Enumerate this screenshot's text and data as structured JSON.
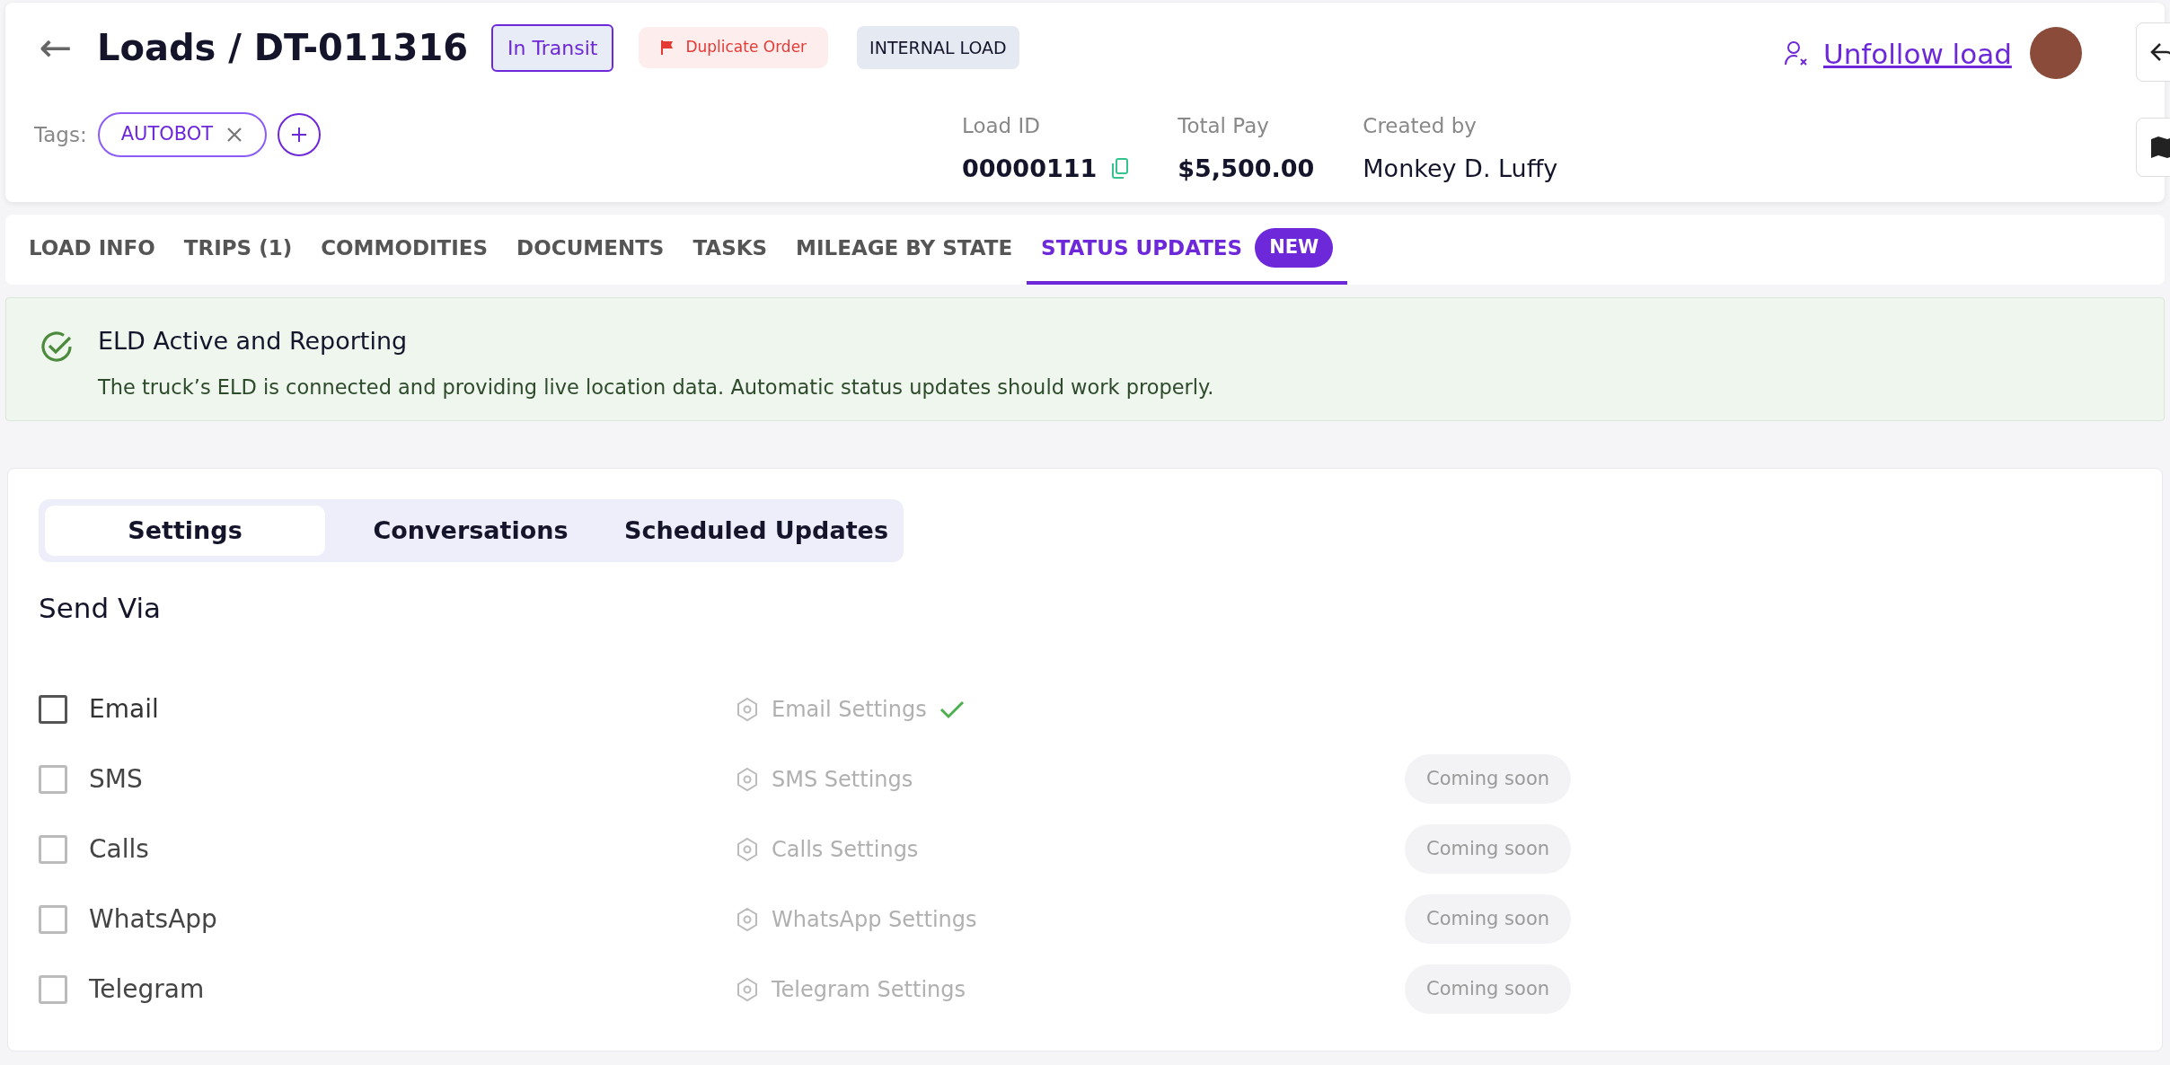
{
  "header": {
    "back": "←",
    "breadcrumb": "Loads / DT-011316",
    "status": "In Transit",
    "flag": "Duplicate Order",
    "load_type": "INTERNAL LOAD",
    "follow_link": "Unfollow load",
    "tags_label": "Tags:",
    "tags": [
      {
        "label": "AUTOBOT"
      }
    ],
    "stats": [
      {
        "label": "Load ID",
        "value": "00000111",
        "kind": "copy"
      },
      {
        "label": "Total Pay",
        "value": "$5,500.00",
        "kind": "bold"
      },
      {
        "label": "Created by",
        "value": "Monkey D. Luffy",
        "kind": "plain"
      }
    ]
  },
  "tabs": [
    {
      "label": "LOAD INFO",
      "selected": false
    },
    {
      "label": "TRIPS  (1)",
      "selected": false
    },
    {
      "label": "COMMODITIES",
      "selected": false
    },
    {
      "label": "DOCUMENTS",
      "selected": false
    },
    {
      "label": "TASKS",
      "selected": false
    },
    {
      "label": "MILEAGE BY STATE",
      "selected": false
    },
    {
      "label": "STATUS UPDATES",
      "selected": true,
      "badge": "NEW"
    }
  ],
  "banner": {
    "title": "ELD Active and Reporting",
    "message": "The truck’s ELD is connected and providing live location data. Automatic status updates should work properly."
  },
  "subtabs": [
    {
      "label": "Settings",
      "selected": true
    },
    {
      "label": "Conversations",
      "selected": false
    },
    {
      "label": "Scheduled Updates",
      "selected": false
    }
  ],
  "send_via": {
    "title": "Send Via",
    "channels": [
      {
        "label": "Email",
        "checked": false,
        "disabled": false,
        "settings": "Email Settings",
        "configured": true
      },
      {
        "label": "SMS",
        "checked": false,
        "disabled": true,
        "settings": "SMS Settings",
        "configured": false,
        "badge": "Coming soon"
      },
      {
        "label": "Calls",
        "checked": false,
        "disabled": true,
        "settings": "Calls Settings",
        "configured": false,
        "badge": "Coming soon"
      },
      {
        "label": "WhatsApp",
        "checked": false,
        "disabled": true,
        "settings": "WhatsApp Settings",
        "configured": false,
        "badge": "Coming soon"
      },
      {
        "label": "Telegram",
        "checked": false,
        "disabled": true,
        "settings": "Telegram Settings",
        "configured": false,
        "badge": "Coming soon"
      }
    ]
  }
}
